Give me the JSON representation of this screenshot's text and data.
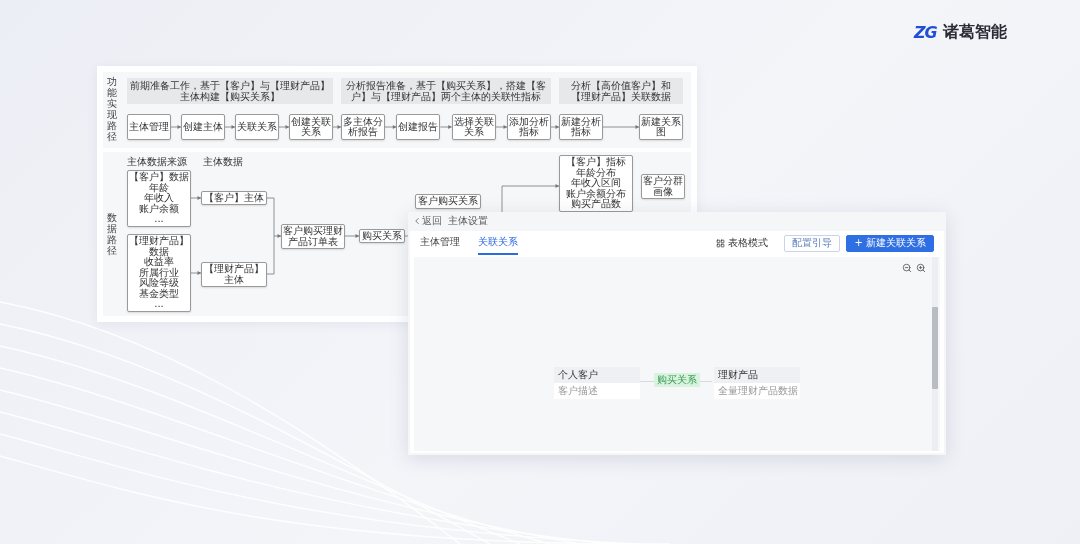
{
  "logo": {
    "mark": "ZG",
    "name": "诸葛智能"
  },
  "flow_chart": {
    "function_row": {
      "label": "功能实现路径",
      "stages": [
        {
          "title": "前期准备工作，基于【客户】与【理财产品】主体构建【购买关系】",
          "steps": [
            "主体管理",
            "创建主体",
            "关联关系",
            "创建关联关系"
          ]
        },
        {
          "title": "分析报告准备，基于【购买关系】，搭建【客户】与【理财产品】两个主体的关联性指标",
          "steps": [
            "多主体分析报告",
            "创建报告",
            "选择关联关系",
            "添加分析指标"
          ]
        },
        {
          "title": "分析【高价值客户】和【理财产品】关联数据",
          "steps": [
            "新建分析指标",
            "新建关系图"
          ]
        }
      ]
    },
    "data_row": {
      "label": "数据路径",
      "column_headers": [
        "主体数据来源",
        "主体数据"
      ],
      "sources": [
        {
          "title": "【客户】数据",
          "items": [
            "年龄",
            "年收入",
            "账户余额",
            "..."
          ]
        },
        {
          "title": "【理财产品】数据",
          "items": [
            "收益率",
            "所属行业",
            "风险等级",
            "基金类型",
            "..."
          ]
        }
      ],
      "entities": [
        "【客户】主体",
        "【理财产品】主体"
      ],
      "order_table": "客户购买理财产品订单表",
      "relation": "购买关系",
      "relation_table": "客户购买关系",
      "metrics": {
        "title": "【客户】指标",
        "items": [
          "年龄分布",
          "年收入区间",
          "账户余额分布",
          "购买产品数"
        ]
      },
      "segment": "客户分群画像"
    }
  },
  "settings_window": {
    "back": "返回",
    "title": "主体设置",
    "tabs": [
      {
        "label": "主体管理",
        "selected": false
      },
      {
        "label": "关联关系",
        "selected": true
      }
    ],
    "table_mode": "表格模式",
    "buttons": [
      {
        "label": "配置引导",
        "kind": "secondary"
      },
      {
        "label": "+ 新建关联关系",
        "kind": "primary"
      }
    ],
    "graph": {
      "nodes": [
        {
          "title": "个人客户",
          "subtitle": "客户描述"
        },
        {
          "title": "理财产品",
          "subtitle": "全量理财产品数据"
        }
      ],
      "edge_label": "购买关系"
    }
  }
}
